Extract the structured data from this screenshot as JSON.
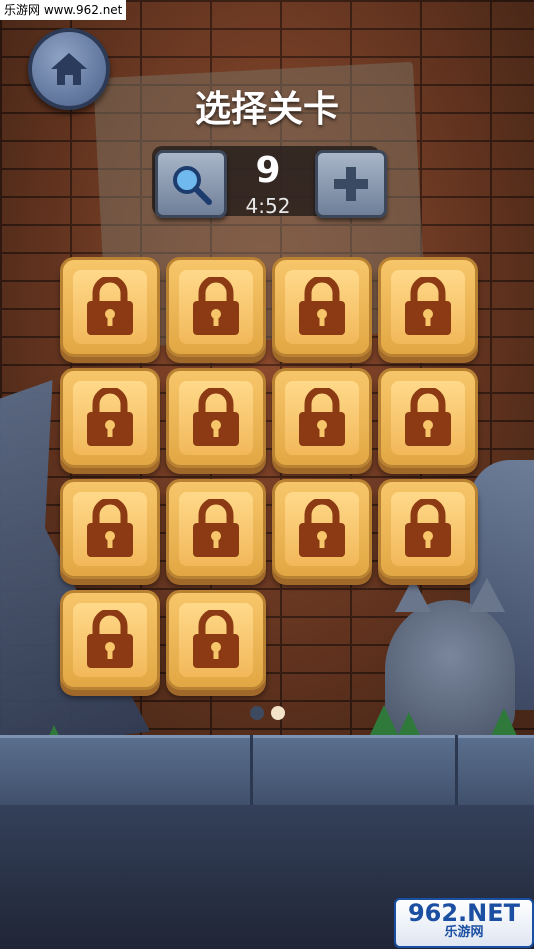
{
  "watermark": {
    "site_text": "乐游网 www.962.net",
    "logo_text": "962.NET",
    "logo_sub": "乐游网"
  },
  "header": {
    "title": "选择关卡",
    "home_icon": "home-icon"
  },
  "hints": {
    "count": "9",
    "timer": "4:52",
    "search_icon": "magnifier-icon",
    "add_icon": "plus-icon"
  },
  "levels": [
    {
      "state": "locked"
    },
    {
      "state": "locked"
    },
    {
      "state": "locked"
    },
    {
      "state": "locked"
    },
    {
      "state": "locked"
    },
    {
      "state": "locked"
    },
    {
      "state": "locked"
    },
    {
      "state": "locked"
    },
    {
      "state": "locked"
    },
    {
      "state": "locked"
    },
    {
      "state": "locked"
    },
    {
      "state": "locked"
    },
    {
      "state": "locked"
    },
    {
      "state": "locked"
    }
  ],
  "pagination": {
    "pages": 2,
    "current": 2
  },
  "colors": {
    "tile": "#f2b85a",
    "lock": "#8b3a14",
    "title": "#ffffff"
  }
}
